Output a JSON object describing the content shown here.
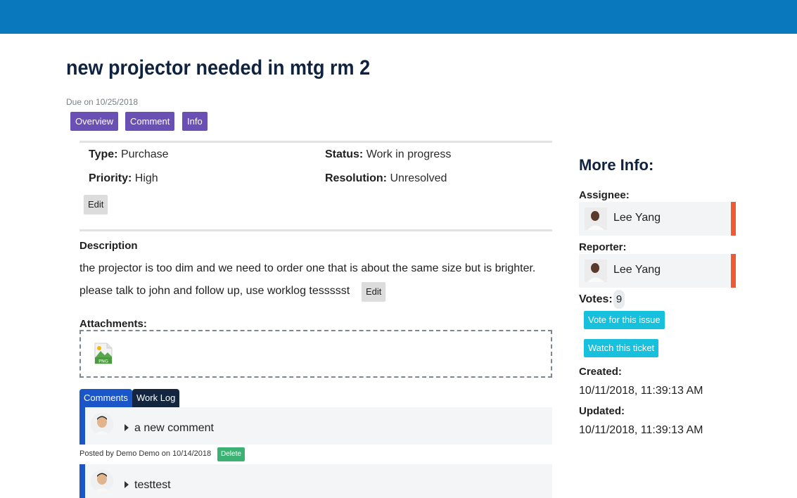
{
  "header": {
    "bar_color": "#0a78bd"
  },
  "ticket": {
    "title": "new projector needed in mtg rm 2",
    "due": "Due on 10/25/2018"
  },
  "tabs": [
    {
      "label": "Overview"
    },
    {
      "label": "Comment"
    },
    {
      "label": "Info"
    }
  ],
  "details": {
    "type_label": "Type:",
    "type_value": "Purchase",
    "status_label": "Status:",
    "status_value": "Work in progress",
    "priority_label": "Priority:",
    "priority_value": "High",
    "resolution_label": "Resolution:",
    "resolution_value": "Unresolved",
    "edit_label": "Edit"
  },
  "description": {
    "heading": "Description",
    "line1": "the projector is too dim and we need to order one that is about the same size but is brighter.",
    "line2": "please talk to john and follow up, use worklog tessssst",
    "edit_label": "Edit"
  },
  "attachments": {
    "heading": "Attachments:",
    "file_icon": "png-file-icon",
    "file_badge": "PNG"
  },
  "comment_tabs": [
    {
      "label": "Comments",
      "color": "#1a56c8"
    },
    {
      "label": "Work Log",
      "color": "#13253f"
    }
  ],
  "comments": [
    {
      "text": "a new comment",
      "posted": "Posted by Demo Demo on 10/14/2018",
      "delete_label": "Delete"
    },
    {
      "text": "testtest"
    }
  ],
  "sidebar": {
    "title": "More Info:",
    "assignee_label": "Assignee:",
    "assignee_name": "Lee Yang",
    "reporter_label": "Reporter:",
    "reporter_name": "Lee Yang",
    "votes_label": "Votes:",
    "votes_count": "9",
    "vote_button": "Vote for this issue",
    "watch_button": "Watch this ticket",
    "created_label": "Created:",
    "created_value": "10/11/2018, 11:39:13 AM",
    "updated_label": "Updated:",
    "updated_value": "10/11/2018, 11:39:13 AM",
    "accent_color": "#ee5a34"
  }
}
